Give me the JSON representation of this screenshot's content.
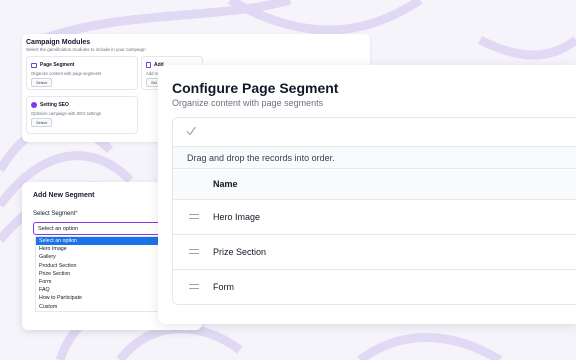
{
  "modules_card": {
    "title": "Campaign Modules",
    "subtitle": "Select the gamification modules to include in your campaign",
    "tiles": [
      {
        "title": "Page Segment",
        "description": "Organize content with page segments",
        "button": "Select",
        "icon": "grid-icon"
      },
      {
        "title": "Add",
        "description": "Add m",
        "button": "Sel",
        "icon": "document-icon"
      },
      {
        "title": "Setting SEO",
        "description": "Optimize campaign with SEO settings",
        "button": "Select",
        "icon": "seo-icon"
      }
    ]
  },
  "add_segment": {
    "title": "Add New Segment",
    "label": "Select Segment",
    "required_mark": "*",
    "select_value": "Select an option",
    "options": [
      "Select an option",
      "Hero Image",
      "Gallery",
      "Product Section",
      "Prize Section",
      "Form",
      "FAQ",
      "How to Participate",
      "Custom"
    ],
    "selected_index": 0
  },
  "configure": {
    "title": "Configure Page Segment",
    "subtitle": "Organize content with page segments",
    "hint": "Drag and drop the records into order.",
    "column_name": "Name",
    "rows": [
      "Hero Image",
      "Prize Section",
      "Form"
    ]
  },
  "colors": {
    "accent": "#7c3aed",
    "option_highlight": "#1a73e8",
    "background": "#f6f4fb"
  }
}
